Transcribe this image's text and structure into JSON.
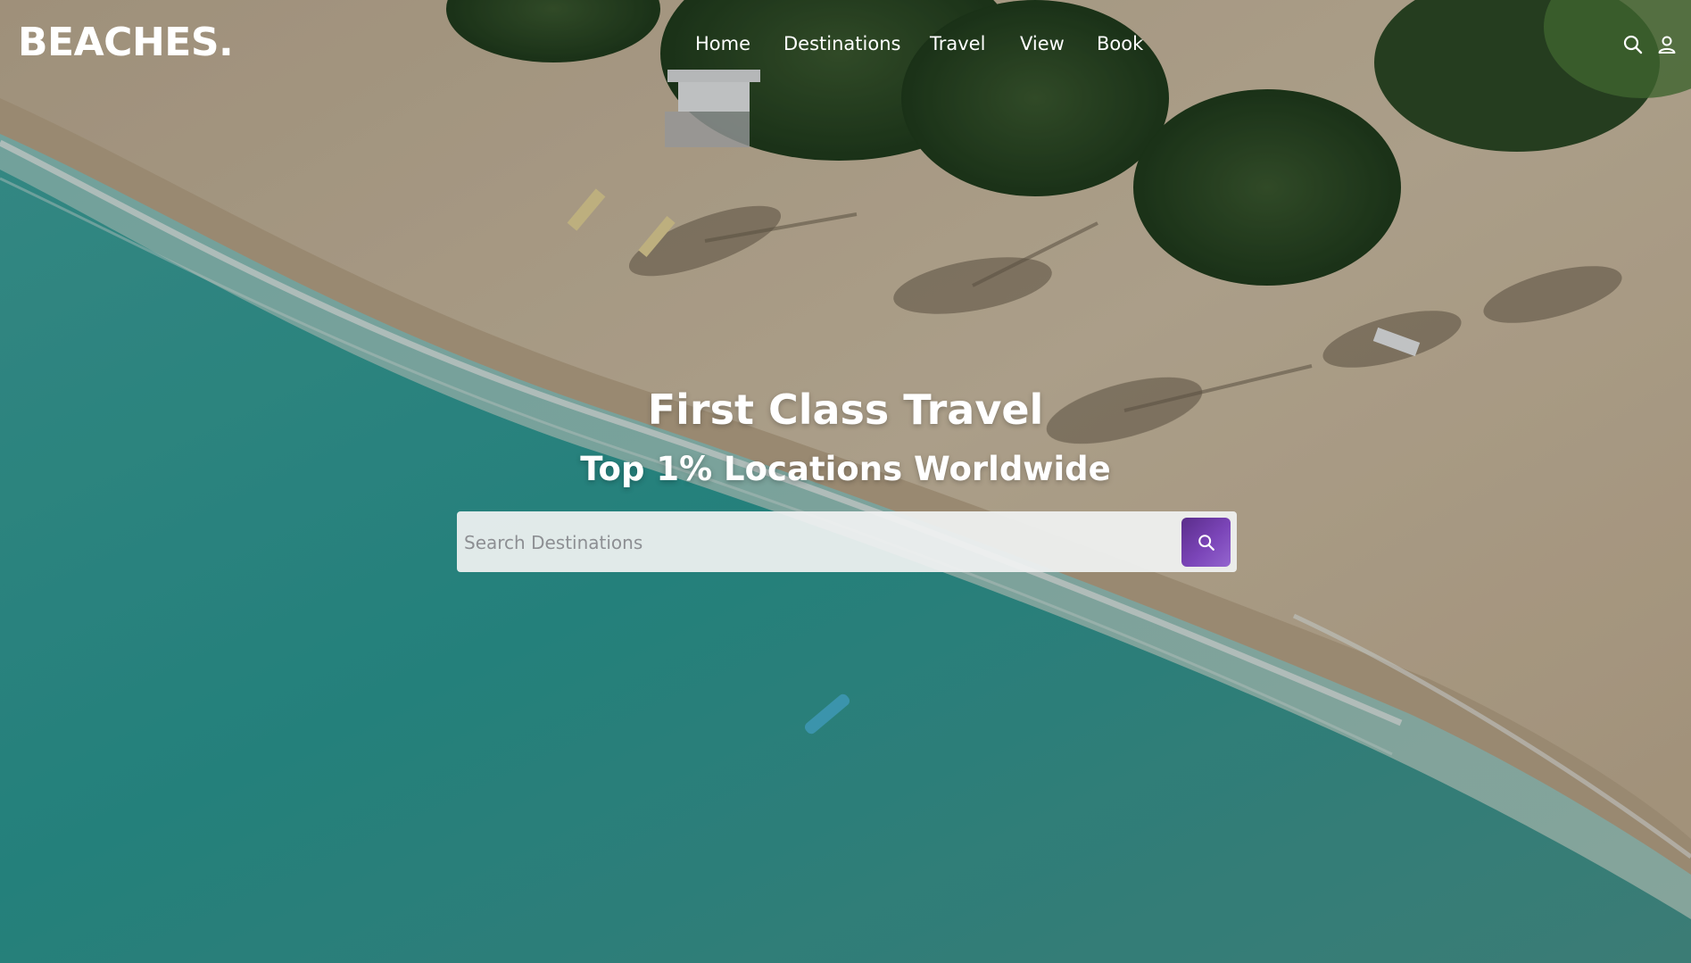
{
  "header": {
    "logo": "BEACHES.",
    "nav": [
      {
        "label": "Home"
      },
      {
        "label": "Destinations"
      },
      {
        "label": "Travel"
      },
      {
        "label": "View"
      },
      {
        "label": "Book"
      }
    ],
    "icons": [
      "search-icon",
      "user-icon"
    ]
  },
  "hero": {
    "title": "First Class Travel",
    "subtitle": "Top 1% Locations Worldwide",
    "search": {
      "placeholder": "Search Destinations",
      "value": "",
      "button_icon": "search-icon"
    }
  },
  "colors": {
    "text": "#ffffff",
    "search_button": "#6e3ba8",
    "search_field": "#f0f2f2",
    "sea": "#2aa39c",
    "sand": "#d8c4a6"
  }
}
